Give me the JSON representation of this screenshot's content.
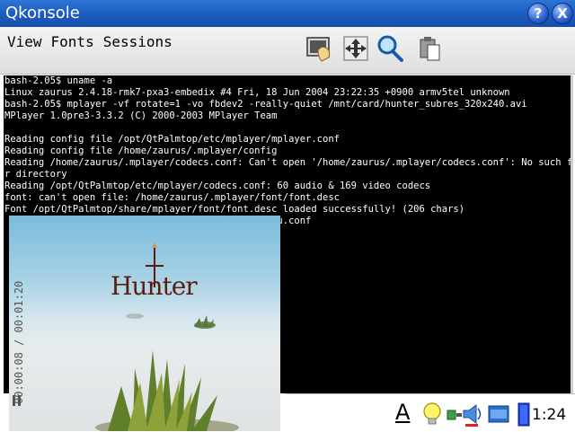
{
  "window": {
    "title": "Qkonsole"
  },
  "titlebar_buttons": {
    "help": "?",
    "close": "X"
  },
  "menu": {
    "items": [
      {
        "label": "View"
      },
      {
        "label": "Fonts"
      },
      {
        "label": "Sessions"
      }
    ]
  },
  "toolbar": {
    "icons": [
      "screen-icon",
      "move-icon",
      "magnifier-icon",
      "clipboard-icon"
    ]
  },
  "terminal": {
    "lines": [
      "bash-2.05$ uname -a",
      "Linux zaurus 2.4.18-rmk7-pxa3-embedix #4 Fri, 18 Jun 2004 23:22:35 +0900 armv5tel unknown",
      "bash-2.05$ mplayer -vf rotate=1 -vo fbdev2 -really-quiet /mnt/card/hunter_subres_320x240.avi",
      "MPlayer 1.0pre3-3.3.2 (C) 2000-2003 MPlayer Team",
      "",
      "Reading config file /opt/QtPalmtop/etc/mplayer/mplayer.conf",
      "Reading config file /home/zaurus/.mplayer/config",
      "Reading /home/zaurus/.mplayer/codecs.conf: Can't open '/home/zaurus/.mplayer/codecs.conf': No such file o",
      "r directory",
      "Reading /opt/QtPalmtop/etc/mplayer/codecs.conf: 60 audio & 169 video codecs",
      "font: can't open file: /home/zaurus/.mplayer/font/font.desc",
      "Font /opt/QtPalmtop/share/mplayer/font/font.desc loaded successfully! (206 chars)",
      "                                              enu.conf"
    ]
  },
  "video": {
    "logo_text": "Hunter",
    "timecode": "00:00:08 / 00:01:20"
  },
  "taskbar": {
    "input_method_label": "A",
    "clock": "1:24"
  },
  "colors": {
    "titlebar": "#1c5cc0",
    "terminal_bg": "#000000",
    "terminal_fg": "#ffffff"
  }
}
